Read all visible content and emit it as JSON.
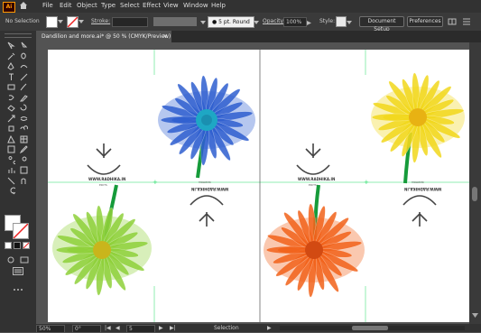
{
  "menubar": {
    "logo": "Ai",
    "items": [
      "File",
      "Edit",
      "Object",
      "Type",
      "Select",
      "Effect",
      "View",
      "Window",
      "Help"
    ]
  },
  "control": {
    "selection": "No Selection",
    "stroke_label": "Stroke:",
    "brush": "5 pt. Round",
    "opacity_label": "Opacity:",
    "opacity_value": "100%",
    "style_label": "Style:",
    "document_setup": "Document Setup",
    "preferences": "Preferences"
  },
  "tab": {
    "title": "Dandilion and more.ai* @ 50 % (CMYK/Preview)",
    "close": "×"
  },
  "artwork": {
    "logo_text": "WWW.RADHIKA.IN",
    "logo_small_top": "RADHIKA",
    "logo_small_bottom": "EDITS"
  },
  "status": {
    "zoom": "50%",
    "rotation": "0°",
    "artboard": "5",
    "mode": "Selection"
  },
  "colors": {
    "accent": "#ff9a00",
    "guide": "#22dd66",
    "flower_blue": "#2f5fd0",
    "flower_yellow": "#f2d81c",
    "flower_green": "#8fd13a",
    "flower_orange": "#f2621a",
    "stem": "#169b3a"
  }
}
